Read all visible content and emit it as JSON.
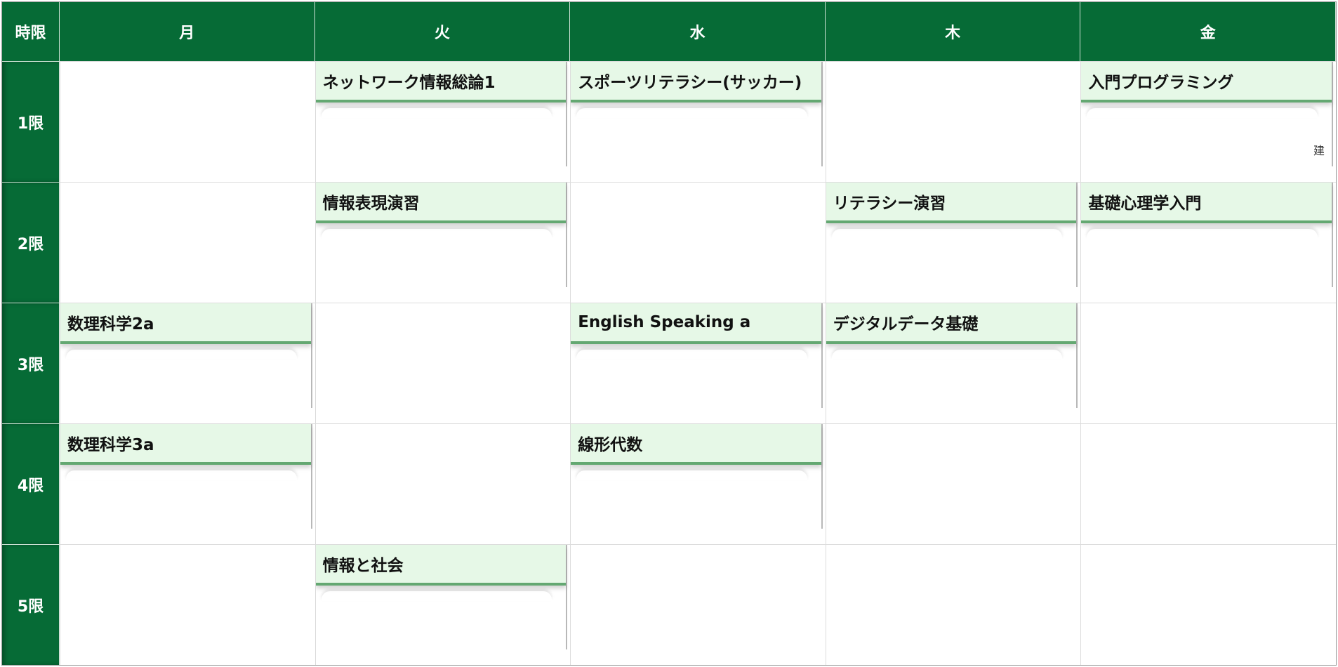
{
  "header": {
    "period_col": "時限",
    "days": [
      "月",
      "火",
      "水",
      "木",
      "金"
    ]
  },
  "periods": [
    "1限",
    "2限",
    "3限",
    "4限",
    "5限"
  ],
  "courses": [
    {
      "day": 1,
      "period": 0,
      "title": "ネットワーク情報総論1",
      "room": ""
    },
    {
      "day": 2,
      "period": 0,
      "title": "スポーツリテラシー(サッカー)",
      "room": ""
    },
    {
      "day": 4,
      "period": 0,
      "title": "入門プログラミング",
      "room": "建"
    },
    {
      "day": 1,
      "period": 1,
      "title": "情報表現演習",
      "room": ""
    },
    {
      "day": 3,
      "period": 1,
      "title": "リテラシー演習",
      "room": ""
    },
    {
      "day": 4,
      "period": 1,
      "title": "基礎心理学入門",
      "room": ""
    },
    {
      "day": 0,
      "period": 2,
      "title": "数理科学2a",
      "room": ""
    },
    {
      "day": 2,
      "period": 2,
      "title": "English Speaking a",
      "room": ""
    },
    {
      "day": 3,
      "period": 2,
      "title": "デジタルデータ基礎",
      "room": ""
    },
    {
      "day": 0,
      "period": 3,
      "title": "数理科学3a",
      "room": ""
    },
    {
      "day": 2,
      "period": 3,
      "title": "線形代数",
      "room": ""
    },
    {
      "day": 1,
      "period": 4,
      "title": "情報と社会",
      "room": ""
    }
  ],
  "colors": {
    "header_bg": "#066b36",
    "course_title_bg": "#e6f8e7",
    "course_accent": "#64a872"
  }
}
